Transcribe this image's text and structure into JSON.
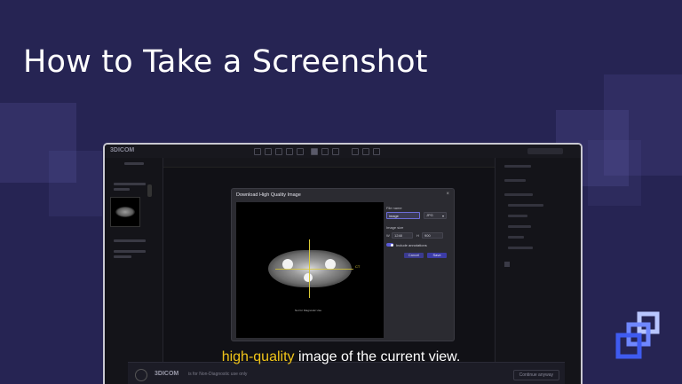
{
  "slide": {
    "title": "How to Take a Screenshot",
    "subtitle_highlight": "high-quality",
    "subtitle_rest": " image of the current view."
  },
  "app": {
    "logo": "3DICOM",
    "disclaimer": {
      "logo": "3DICOM",
      "text": "is for Non-Diagnostic use only",
      "button": "Continue anyway"
    }
  },
  "dialog": {
    "title": "Download High Quality Image",
    "close": "×",
    "file_name_label": "File name",
    "file_name_value": "image",
    "format_value": "JPG",
    "image_size_label": "Image size",
    "width_prefix": "W",
    "width_value": "1248",
    "height_prefix": "H",
    "height_value": "900",
    "include_annotations_label": "Include annotations",
    "include_annotations_on": true,
    "cancel_label": "Cancel",
    "save_label": "Save",
    "preview_caption": "Not for Diagnostic Use",
    "measurement_tag": "CT"
  },
  "colors": {
    "background": "#262453",
    "highlight": "#f0c419",
    "accent": "#5b5bd6"
  }
}
